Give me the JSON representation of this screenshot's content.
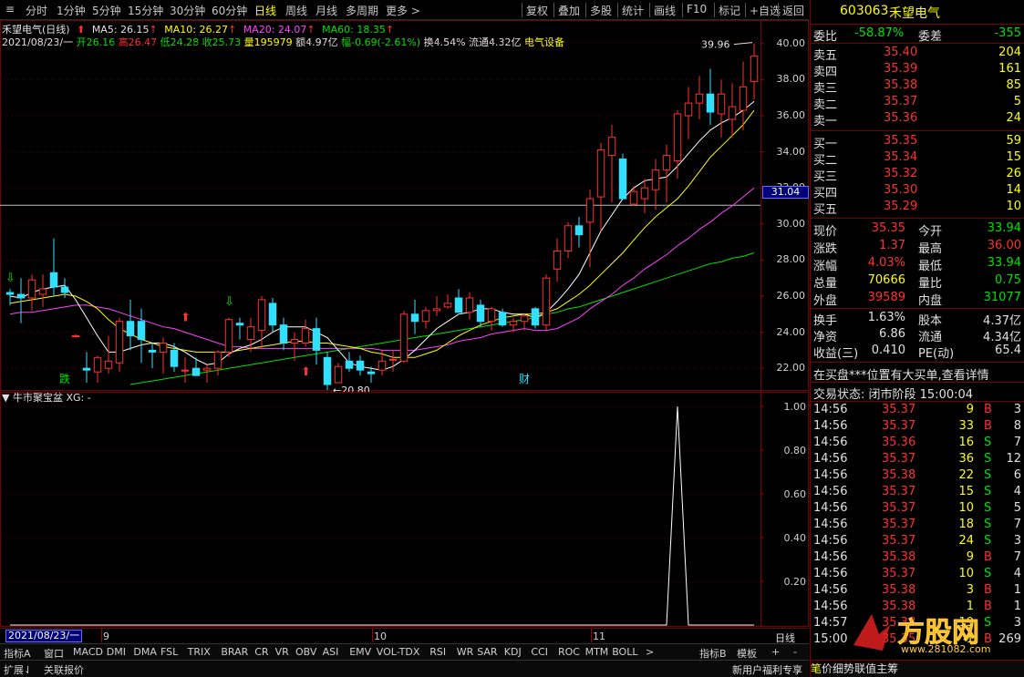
{
  "toolbar": {
    "periods": [
      "分时",
      "1分钟",
      "5分钟",
      "15分钟",
      "30分钟",
      "60分钟",
      "日线",
      "周线",
      "月线",
      "多周期",
      "更多 >"
    ],
    "active_index": 6,
    "tools": [
      "复权",
      "叠加",
      "多股",
      "统计",
      "画线",
      "F10",
      "标记",
      "+自选",
      "返回"
    ]
  },
  "info": {
    "stock": "禾望电气(日线)",
    "ma5": "MA5: 26.15",
    "ma10": "MA10: 26.27",
    "ma20": "MA20: 24.07",
    "ma60": "MA60: 18.35",
    "date": "2021/08/23/一",
    "open": "开26.16",
    "high": "高26.47",
    "low": "低24.28",
    "close": "收25.73",
    "vol": "量195979",
    "amount": "额4.97亿",
    "range": "幅-0.69(-2.61%)",
    "turnover": "换4.54%",
    "float": "流通4.32亿",
    "sector": "电气设备"
  },
  "chart_data": [
    {
      "type": "candlestick",
      "title": "禾望电气(日线)",
      "ylim": [
        21.0,
        41.0
      ],
      "yticks": [
        "40.00",
        "38.00",
        "36.00",
        "34.00",
        "32.00",
        "30.00",
        "28.00",
        "26.00",
        "24.00",
        "22.00"
      ],
      "crosshair_value": "31.04",
      "high_annotation": "39.96",
      "low_annotation": "20.80",
      "x_labels": [
        "2021/08/23/一",
        "9",
        "10",
        "11"
      ],
      "markers": [
        "跌",
        "财"
      ],
      "colors": {
        "up": "#ff3030",
        "down": "#30e0ff",
        "ma5": "#ffffff",
        "ma10": "#ffff00",
        "ma20": "#ff40ff",
        "ma60": "#00e000"
      },
      "candles": [
        {
          "o": 26.2,
          "h": 26.4,
          "l": 25.5,
          "c": 26.1
        },
        {
          "o": 26.1,
          "h": 27.0,
          "l": 24.5,
          "c": 25.9
        },
        {
          "o": 25.9,
          "h": 27.2,
          "l": 25.2,
          "c": 26.9
        },
        {
          "o": 26.1,
          "h": 27.2,
          "l": 25.4,
          "c": 26.4
        },
        {
          "o": 27.3,
          "h": 29.2,
          "l": 26.0,
          "c": 26.5
        },
        {
          "o": 26.5,
          "h": 27.0,
          "l": 25.9,
          "c": 26.2
        },
        {
          "o": 23.8,
          "h": 23.9,
          "l": 23.7,
          "c": 23.8
        },
        {
          "o": 22.0,
          "h": 22.9,
          "l": 21.2,
          "c": 21.9
        },
        {
          "o": 21.8,
          "h": 22.7,
          "l": 21.2,
          "c": 22.6
        },
        {
          "o": 22.0,
          "h": 23.8,
          "l": 21.7,
          "c": 22.4
        },
        {
          "o": 22.3,
          "h": 24.8,
          "l": 21.8,
          "c": 24.6
        },
        {
          "o": 24.6,
          "h": 25.8,
          "l": 23.0,
          "c": 23.8
        },
        {
          "o": 24.6,
          "h": 25.3,
          "l": 22.3,
          "c": 23.6
        },
        {
          "o": 23.0,
          "h": 23.4,
          "l": 22.0,
          "c": 22.9
        },
        {
          "o": 22.9,
          "h": 23.7,
          "l": 21.7,
          "c": 23.4
        },
        {
          "o": 23.0,
          "h": 23.4,
          "l": 21.8,
          "c": 22.1
        },
        {
          "o": 21.9,
          "h": 22.6,
          "l": 21.2,
          "c": 21.9
        },
        {
          "o": 22.0,
          "h": 22.6,
          "l": 21.6,
          "c": 21.6
        },
        {
          "o": 21.9,
          "h": 22.2,
          "l": 21.2,
          "c": 22.0
        },
        {
          "o": 22.0,
          "h": 23.0,
          "l": 21.6,
          "c": 22.9
        },
        {
          "o": 22.9,
          "h": 24.8,
          "l": 22.6,
          "c": 24.7
        },
        {
          "o": 24.5,
          "h": 24.8,
          "l": 23.6,
          "c": 24.4
        },
        {
          "o": 23.6,
          "h": 24.8,
          "l": 22.9,
          "c": 24.3
        },
        {
          "o": 24.1,
          "h": 26.0,
          "l": 23.1,
          "c": 25.8
        },
        {
          "o": 25.6,
          "h": 25.9,
          "l": 24.0,
          "c": 24.4
        },
        {
          "o": 24.4,
          "h": 24.8,
          "l": 23.0,
          "c": 23.4
        },
        {
          "o": 23.4,
          "h": 24.0,
          "l": 22.4,
          "c": 23.6
        },
        {
          "o": 23.4,
          "h": 24.7,
          "l": 23.2,
          "c": 24.2
        },
        {
          "o": 24.2,
          "h": 24.8,
          "l": 22.2,
          "c": 23.0
        },
        {
          "o": 22.6,
          "h": 22.9,
          "l": 20.8,
          "c": 21.1
        },
        {
          "o": 21.2,
          "h": 22.3,
          "l": 21.2,
          "c": 22.1
        },
        {
          "o": 22.4,
          "h": 22.9,
          "l": 21.8,
          "c": 22.0
        },
        {
          "o": 22.4,
          "h": 22.7,
          "l": 21.6,
          "c": 21.9
        },
        {
          "o": 21.8,
          "h": 22.1,
          "l": 21.2,
          "c": 21.7
        },
        {
          "o": 21.9,
          "h": 23.0,
          "l": 21.6,
          "c": 22.4
        },
        {
          "o": 22.5,
          "h": 23.0,
          "l": 21.8,
          "c": 22.5
        },
        {
          "o": 22.4,
          "h": 25.2,
          "l": 22.3,
          "c": 25.0
        },
        {
          "o": 25.0,
          "h": 25.8,
          "l": 23.9,
          "c": 24.6
        },
        {
          "o": 24.6,
          "h": 25.4,
          "l": 24.2,
          "c": 25.2
        },
        {
          "o": 25.2,
          "h": 26.0,
          "l": 24.9,
          "c": 25.3
        },
        {
          "o": 25.4,
          "h": 26.1,
          "l": 25.3,
          "c": 25.6
        },
        {
          "o": 25.9,
          "h": 26.4,
          "l": 25.3,
          "c": 25.1
        },
        {
          "o": 25.1,
          "h": 26.2,
          "l": 24.7,
          "c": 25.9
        },
        {
          "o": 25.5,
          "h": 25.8,
          "l": 24.3,
          "c": 24.6
        },
        {
          "o": 24.6,
          "h": 25.4,
          "l": 24.1,
          "c": 25.3
        },
        {
          "o": 25.1,
          "h": 25.3,
          "l": 24.3,
          "c": 24.4
        },
        {
          "o": 24.4,
          "h": 24.8,
          "l": 24.0,
          "c": 24.6
        },
        {
          "o": 24.6,
          "h": 25.0,
          "l": 24.1,
          "c": 24.9
        },
        {
          "o": 25.3,
          "h": 25.4,
          "l": 24.2,
          "c": 24.4
        },
        {
          "o": 24.4,
          "h": 27.2,
          "l": 24.1,
          "c": 27.0
        },
        {
          "o": 27.5,
          "h": 29.2,
          "l": 26.8,
          "c": 28.5
        },
        {
          "o": 28.5,
          "h": 30.1,
          "l": 28.1,
          "c": 29.9
        },
        {
          "o": 29.9,
          "h": 30.4,
          "l": 28.7,
          "c": 29.4
        },
        {
          "o": 30.1,
          "h": 31.9,
          "l": 27.6,
          "c": 31.4
        },
        {
          "o": 31.5,
          "h": 34.5,
          "l": 29.6,
          "c": 34.1
        },
        {
          "o": 33.8,
          "h": 35.5,
          "l": 31.2,
          "c": 34.8
        },
        {
          "o": 33.6,
          "h": 33.9,
          "l": 31.4,
          "c": 31.4
        },
        {
          "o": 31.1,
          "h": 32.1,
          "l": 31.0,
          "c": 31.8
        },
        {
          "o": 31.4,
          "h": 32.5,
          "l": 30.6,
          "c": 32.0
        },
        {
          "o": 31.9,
          "h": 33.6,
          "l": 30.8,
          "c": 33.0
        },
        {
          "o": 33.0,
          "h": 34.4,
          "l": 31.2,
          "c": 33.8
        },
        {
          "o": 33.5,
          "h": 36.3,
          "l": 32.5,
          "c": 36.1
        },
        {
          "o": 36.0,
          "h": 37.6,
          "l": 34.7,
          "c": 36.7
        },
        {
          "o": 36.7,
          "h": 38.2,
          "l": 35.8,
          "c": 37.2
        },
        {
          "o": 37.2,
          "h": 38.6,
          "l": 35.5,
          "c": 36.2
        },
        {
          "o": 36.1,
          "h": 38.0,
          "l": 34.8,
          "c": 37.2
        },
        {
          "o": 35.8,
          "h": 37.8,
          "l": 34.8,
          "c": 36.5
        },
        {
          "o": 36.3,
          "h": 39.0,
          "l": 35.2,
          "c": 37.6
        },
        {
          "o": 37.9,
          "h": 40.0,
          "l": 36.9,
          "c": 39.3
        }
      ],
      "ma5": [
        26.0,
        25.9,
        26.2,
        26.4,
        26.5,
        26.6,
        25.8,
        24.8,
        23.8,
        22.9,
        22.9,
        23.1,
        23.3,
        23.4,
        23.4,
        23.2,
        22.9,
        22.5,
        22.2,
        22.3,
        22.8,
        23.1,
        23.3,
        23.6,
        24.0,
        24.3,
        24.3,
        24.3,
        24.0,
        23.7,
        23.0,
        22.3,
        22.1,
        22.0,
        21.9,
        22.1,
        22.5,
        23.0,
        23.6,
        24.2,
        24.6,
        25.0,
        25.1,
        25.3,
        25.3,
        25.1,
        25.0,
        25.0,
        24.8,
        25.1,
        25.7,
        26.4,
        27.2,
        28.4,
        29.6,
        30.5,
        31.4,
        32.0,
        32.4,
        32.5,
        32.6,
        33.2,
        33.9,
        34.6,
        35.2,
        35.6,
        35.9,
        36.3,
        36.8
      ],
      "ma10": [
        25.6,
        25.7,
        25.8,
        25.9,
        26.0,
        26.1,
        26.0,
        25.7,
        25.3,
        24.7,
        24.2,
        23.9,
        23.6,
        23.4,
        23.2,
        23.1,
        23.0,
        22.9,
        22.9,
        22.9,
        22.9,
        23.0,
        23.1,
        23.2,
        23.3,
        23.4,
        23.5,
        23.5,
        23.4,
        23.4,
        23.3,
        23.2,
        23.1,
        22.9,
        22.8,
        22.6,
        22.6,
        22.6,
        22.8,
        23.0,
        23.4,
        23.8,
        24.1,
        24.4,
        24.6,
        24.8,
        24.9,
        25.0,
        25.0,
        25.1,
        25.3,
        25.7,
        26.1,
        26.6,
        27.2,
        27.8,
        28.4,
        29.1,
        29.8,
        30.4,
        30.9,
        31.4,
        32.1,
        32.9,
        33.7,
        34.3,
        34.9,
        35.5,
        36.3
      ],
      "ma20": [
        25.0,
        25.1,
        25.1,
        25.2,
        25.3,
        25.4,
        25.5,
        25.5,
        25.4,
        25.3,
        25.1,
        24.9,
        24.7,
        24.5,
        24.3,
        24.2,
        24.0,
        23.8,
        23.6,
        23.4,
        23.2,
        23.2,
        23.1,
        23.1,
        23.1,
        23.1,
        23.1,
        23.1,
        23.1,
        23.1,
        23.1,
        23.1,
        23.1,
        23.1,
        23.0,
        23.0,
        23.0,
        23.0,
        23.1,
        23.2,
        23.3,
        23.5,
        23.6,
        23.7,
        23.9,
        24.0,
        24.1,
        24.2,
        24.1,
        24.1,
        24.2,
        24.5,
        24.8,
        25.3,
        25.7,
        26.1,
        26.6,
        27.0,
        27.5,
        27.9,
        28.3,
        28.8,
        29.2,
        29.7,
        30.1,
        30.6,
        31.0,
        31.5,
        32.0
      ],
      "ma60": [
        null,
        null,
        null,
        null,
        null,
        null,
        null,
        null,
        null,
        null,
        null,
        21.1,
        21.2,
        21.3,
        21.4,
        21.5,
        21.6,
        21.7,
        21.8,
        21.9,
        22.0,
        22.1,
        22.2,
        22.3,
        22.4,
        22.5,
        22.6,
        22.7,
        22.8,
        22.9,
        23.0,
        23.1,
        23.2,
        23.3,
        23.4,
        23.5,
        23.6,
        23.7,
        23.8,
        23.9,
        24.0,
        24.1,
        24.2,
        24.3,
        24.4,
        24.5,
        24.6,
        24.7,
        24.8,
        25.0,
        25.1,
        25.3,
        25.4,
        25.6,
        25.8,
        26.0,
        26.2,
        26.4,
        26.6,
        26.8,
        27.0,
        27.2,
        27.4,
        27.6,
        27.8,
        27.9,
        28.1,
        28.2,
        28.4
      ]
    },
    {
      "type": "line",
      "title": "牛市聚宝盆",
      "series_label": "XG: -",
      "ylim": [
        0,
        1.0
      ],
      "yticks": [
        "1.00",
        "0.80",
        "0.60",
        "0.40",
        "0.20"
      ],
      "values_note_index_of_spike": 51,
      "values": [
        0,
        0,
        0,
        0,
        0,
        0,
        0,
        0,
        0,
        0,
        0,
        0,
        0,
        0,
        0,
        0,
        0,
        0,
        0,
        0,
        0,
        0,
        0,
        0,
        0,
        0,
        0,
        0,
        0,
        0,
        0,
        0,
        0,
        0,
        0,
        0,
        0,
        0,
        0,
        0,
        0,
        0,
        0,
        0,
        0,
        0,
        0,
        0,
        0,
        0,
        0,
        0,
        0,
        0,
        0,
        0,
        0,
        0,
        0,
        0,
        0,
        1,
        0,
        0,
        0,
        0,
        0,
        0,
        0
      ]
    }
  ],
  "right": {
    "code": "603063",
    "name": "禾望电气",
    "webi_label": "委比",
    "webi": "-58.87%",
    "weicha_label": "委差",
    "weicha": "-355",
    "sells": [
      {
        "label": "卖五",
        "price": "35.40",
        "vol": "204"
      },
      {
        "label": "卖四",
        "price": "35.39",
        "vol": "161"
      },
      {
        "label": "卖三",
        "price": "35.38",
        "vol": "85"
      },
      {
        "label": "卖二",
        "price": "35.37",
        "vol": "5"
      },
      {
        "label": "卖一",
        "price": "35.36",
        "vol": "24"
      }
    ],
    "buys": [
      {
        "label": "买一",
        "price": "35.35",
        "vol": "59"
      },
      {
        "label": "买二",
        "price": "35.34",
        "vol": "15"
      },
      {
        "label": "买三",
        "price": "35.32",
        "vol": "26"
      },
      {
        "label": "买四",
        "price": "35.30",
        "vol": "14"
      },
      {
        "label": "买五",
        "price": "35.29",
        "vol": "10"
      }
    ],
    "quote": [
      {
        "l1": "现价",
        "v1": "35.35",
        "c1": "red",
        "l2": "今开",
        "v2": "33.94",
        "c2": "green"
      },
      {
        "l1": "涨跌",
        "v1": "1.37",
        "c1": "red",
        "l2": "最高",
        "v2": "36.00",
        "c2": "red"
      },
      {
        "l1": "涨幅",
        "v1": "4.03%",
        "c1": "red",
        "l2": "最低",
        "v2": "33.94",
        "c2": "green"
      },
      {
        "l1": "总量",
        "v1": "70666",
        "c1": "yellow",
        "l2": "量比",
        "v2": "0.75",
        "c2": "green"
      },
      {
        "l1": "外盘",
        "v1": "39589",
        "c1": "red",
        "l2": "内盘",
        "v2": "31077",
        "c2": "green"
      }
    ],
    "stats": [
      {
        "l1": "换手",
        "v1": "1.63%",
        "l2": "股本",
        "v2": "4.37亿"
      },
      {
        "l1": "净资",
        "v1": "6.86",
        "l2": "流通",
        "v2": "4.34亿"
      },
      {
        "l1": "收益(三)",
        "v1": "0.410",
        "l2": "PE(动)",
        "v2": "65.4"
      }
    ],
    "notice": "在买盘***位置有大买单,查看详情",
    "status": "交易状态: 闭市阶段 15:00:04",
    "ticks": [
      {
        "t": "14:56",
        "p": "35.37",
        "v": "9",
        "s": "B",
        "n": "3"
      },
      {
        "t": "14:56",
        "p": "35.37",
        "v": "33",
        "s": "B",
        "n": "8"
      },
      {
        "t": "14:56",
        "p": "35.36",
        "v": "16",
        "s": "S",
        "n": "7"
      },
      {
        "t": "14:56",
        "p": "35.37",
        "v": "36",
        "s": "S",
        "n": "12"
      },
      {
        "t": "14:56",
        "p": "35.38",
        "v": "22",
        "s": "S",
        "n": "6"
      },
      {
        "t": "14:56",
        "p": "35.37",
        "v": "15",
        "s": "S",
        "n": "4"
      },
      {
        "t": "14:56",
        "p": "35.37",
        "v": "10",
        "s": "S",
        "n": "5"
      },
      {
        "t": "14:56",
        "p": "35.37",
        "v": "18",
        "s": "S",
        "n": "7"
      },
      {
        "t": "14:56",
        "p": "35.37",
        "v": "24",
        "s": "S",
        "n": "3"
      },
      {
        "t": "14:56",
        "p": "35.38",
        "v": "9",
        "s": "B",
        "n": "7"
      },
      {
        "t": "14:56",
        "p": "35.37",
        "v": "10",
        "s": "S",
        "n": "4"
      },
      {
        "t": "14:56",
        "p": "35.38",
        "v": "3",
        "s": "B",
        "n": "1"
      },
      {
        "t": "14:56",
        "p": "35.38",
        "v": "1",
        "s": "B",
        "n": "1"
      },
      {
        "t": "14:57",
        "p": "35.38",
        "v": "19",
        "s": "S",
        "n": "3"
      },
      {
        "t": "15:00",
        "p": "35.35",
        "v": "1",
        "s": "B",
        "n": "269"
      }
    ],
    "bottom_tabs": [
      "笔",
      "价",
      "细",
      "势",
      "联",
      "值",
      "主",
      "筹"
    ]
  },
  "bottom": {
    "indicators": [
      "指标A",
      "窗口",
      "MACD",
      "DMI",
      "DMA",
      "FSL",
      "TRIX",
      "BRAR",
      "CR",
      "VR",
      "OBV",
      "ASI",
      "EMV",
      "VOL-TDX",
      "RSI",
      "WR",
      "SAR",
      "KDJ",
      "CCI",
      "ROC",
      "MTM",
      "BOLL",
      ">"
    ],
    "right_items": [
      "指标B",
      "模板",
      "+",
      "-"
    ],
    "status_left": "扩展⇃",
    "status_mid": "关联报价",
    "status_right": "新用户福利专享",
    "period_tag": "日线"
  },
  "watermark": {
    "text": "www.281082.com",
    "logo": "方股网"
  }
}
